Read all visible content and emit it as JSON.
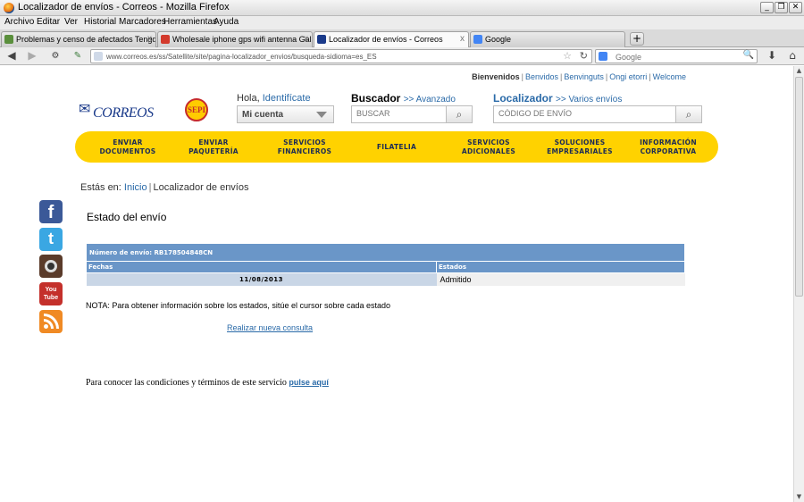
{
  "window": {
    "title": "Localizador de envíos - Correos - Mozilla Firefox",
    "minimize": "_",
    "maximize": "❐",
    "close": "✕"
  },
  "menu": [
    "Archivo",
    "Editar",
    "Ver",
    "Historial",
    "Marcadores",
    "Herramientas",
    "Ayuda"
  ],
  "tabs": [
    {
      "label": "Problemas y censo de afectados Tengda ...",
      "favicon_color": "#5a8f3c"
    },
    {
      "label": "Wholesale iphone gps wifi antenna Galler...",
      "favicon_color": "#d33a2c"
    },
    {
      "label": "Localizador de envíos - Correos",
      "favicon_color": "#1a3a8a"
    },
    {
      "label": "Google",
      "favicon_color": "#4285f4"
    }
  ],
  "tab_close": "x",
  "new_tab": "+",
  "nav": {
    "back": "◀",
    "forward": "▶",
    "home": "⌂",
    "download": "⬇",
    "url": "www.correos.es/ss/Satellite/site/pagina-localizador_envios/busqueda-sidioma=es_ES",
    "bookmark_star": "☆",
    "reload": "↻",
    "search_placeholder": "Google",
    "search_glass": "🔍"
  },
  "header": {
    "toplinks": {
      "welcome": "Bienvenidos",
      "links": [
        "Benvidos",
        "Benvinguts",
        "Ongi etorri",
        "Welcome"
      ]
    },
    "logo_text": "CORREOS",
    "logo_horn": "✉",
    "sepi_text": "SEPI",
    "hello": "Hola,",
    "identify": "Identifícate",
    "account": "Mi cuenta",
    "buscador": {
      "title": "Buscador",
      "sub": ">> Avanzado",
      "placeholder": "BUSCAR"
    },
    "localizador": {
      "title": "Localizador",
      "sub": ">> Varios envíos",
      "placeholder": "CÓDIGO DE ENVÍO"
    },
    "search_button": "⌕"
  },
  "mainnav": [
    "ENVIAR\nDOCUMENTOS",
    "ENVIAR\nPAQUETERÍA",
    "SERVICIOS\nFINANCIEROS",
    "FILATELIA",
    "SERVICIOS\nADICIONALES",
    "SOLUCIONES\nEMPRESARIALES",
    "INFORMACIÓN\nCORPORATIVA"
  ],
  "breadcrumb": {
    "prefix": "Estás en:",
    "home": "Inicio",
    "current": "Localizador de envíos"
  },
  "social": {
    "facebook": "f",
    "twitter": "t",
    "youtube": "You\nTube"
  },
  "colors": {
    "brand_yellow": "#ffd200",
    "brand_blue": "#1b2b56",
    "table_blue": "#6a96c8",
    "link": "#2a6aa8"
  },
  "page_title": "Estado del envío",
  "tracking": {
    "number_label": "Número de envío: RB178504848CN",
    "col_dates": "Fechas",
    "col_states": "Estados",
    "rows": [
      {
        "date": "11/08/2013",
        "state": "Admitido"
      }
    ]
  },
  "note": "NOTA: Para obtener información sobre los estados, sitúe el cursor sobre cada estado",
  "new_query": "Realizar nueva consulta",
  "terms_text": "Para conocer las condiciones y términos de este servicio",
  "terms_link": "pulse aquí",
  "scroll": {
    "up": "▲",
    "down": "▼"
  }
}
